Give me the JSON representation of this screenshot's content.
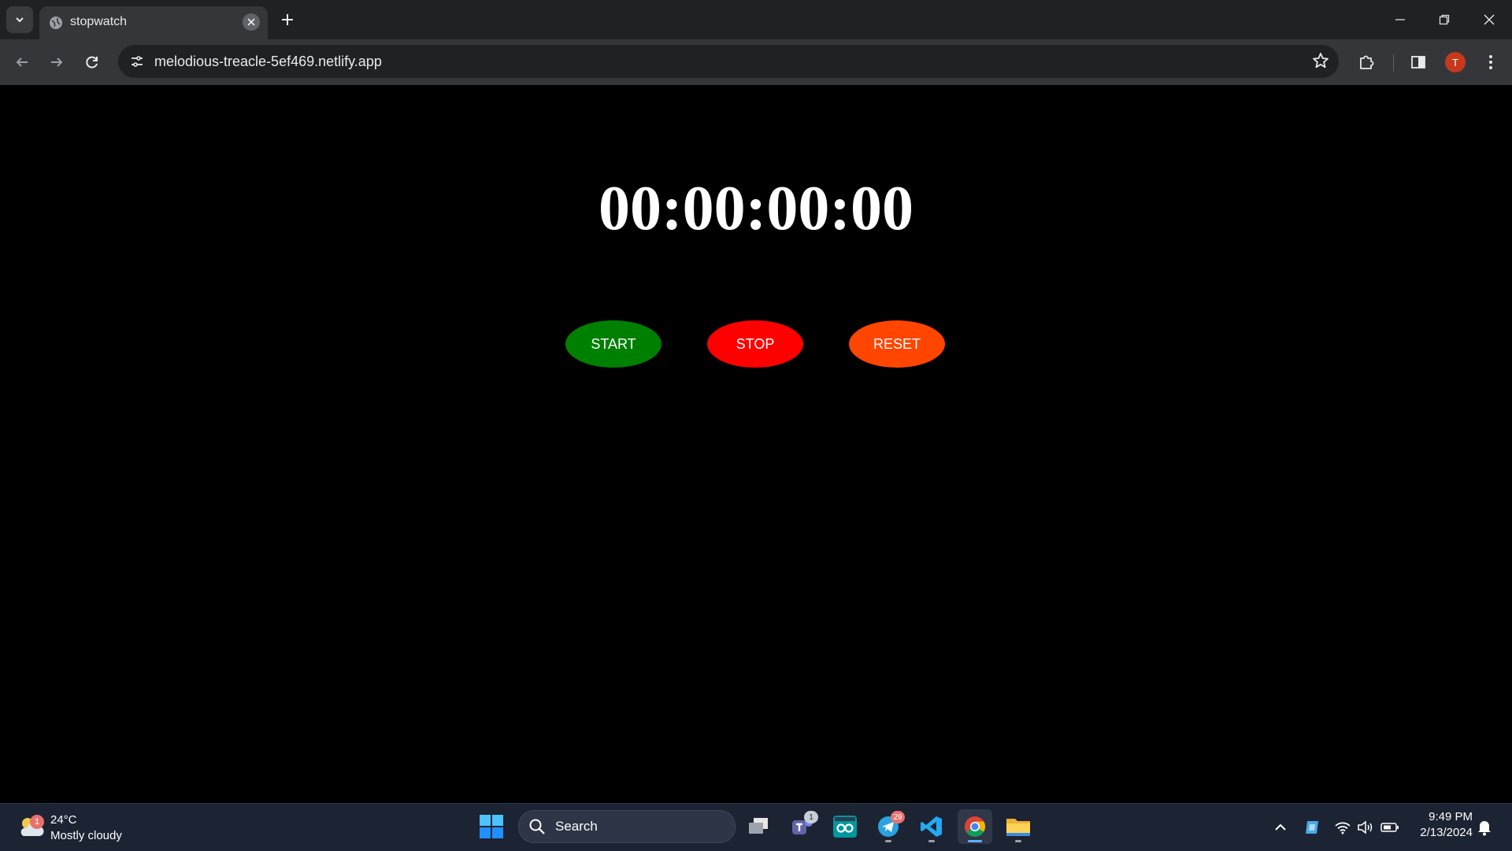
{
  "browser": {
    "tab_title": "stopwatch",
    "url": "melodious-treacle-5ef469.netlify.app",
    "profile_initial": "T"
  },
  "stopwatch": {
    "display": "00:00:00:00",
    "start_label": "START",
    "stop_label": "STOP",
    "reset_label": "RESET",
    "colors": {
      "start": "#008000",
      "stop": "#ff0000",
      "reset": "#ff4500"
    }
  },
  "taskbar": {
    "weather_badge": "1",
    "temperature": "24°C",
    "condition": "Mostly cloudy",
    "search_label": "Search",
    "teams_badge": "1",
    "telegram_badge": "29",
    "time": "9:49 PM",
    "date": "2/13/2024"
  }
}
